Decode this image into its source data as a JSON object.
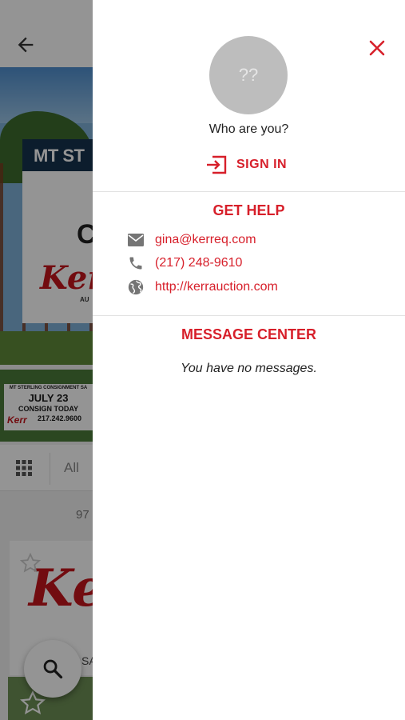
{
  "background": {
    "sign_text": "MT ST",
    "sign_big_letter": "C",
    "sign_logo": "Kerr",
    "sign_logo_sub": "AU",
    "thumb": {
      "line1": "MT STERLING CONSIGNMENT SA",
      "line2": "JULY 23",
      "line3": "CONSIGN TODAY",
      "line4": "217.242.9600",
      "logo": "Kerr"
    },
    "filter_label": "All",
    "count": "97",
    "item_logo": "Ker",
    "item_caption": "SA"
  },
  "drawer": {
    "avatar_text": "??",
    "who_label": "Who are you?",
    "signin_label": "SIGN IN",
    "help": {
      "title": "GET HELP",
      "email": "gina@kerreq.com",
      "phone": "(217) 248-9610",
      "website": "http://kerrauction.com"
    },
    "messages": {
      "title": "MESSAGE CENTER",
      "empty_text": "You have no messages."
    }
  },
  "colors": {
    "accent": "#d71f2a",
    "avatar_bg": "#bdbdbd",
    "scrim": "rgba(0,0,0,0.42)"
  }
}
